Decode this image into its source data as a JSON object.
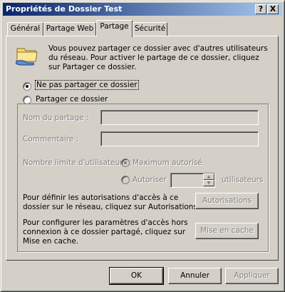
{
  "window": {
    "title": "Propriétés de Dossier Test",
    "help_btn": "?",
    "close_btn": "X"
  },
  "tabs": [
    {
      "label": "Général"
    },
    {
      "label": "Partage Web"
    },
    {
      "label": "Partage"
    },
    {
      "label": "Sécurité"
    }
  ],
  "active_tab": "Partage",
  "intro": {
    "text": "Vous pouvez partager ce dossier avec d'autres utilisateurs\ndu réseau. Pour activer le partage de ce dossier, cliquez\nsur Partager ce dossier."
  },
  "sharing": {
    "no_share_label": "Ne pas partager ce dossier",
    "share_label": "Partager ce dossier",
    "selected": "no_share"
  },
  "fields": {
    "share_name_label": "Nom du partage :",
    "comment_label": "Commentaire :",
    "user_limit_label": "Nombre limite d'utilisateurs :",
    "max_allowed_label": "Maximum autorisé",
    "allow_label": "Autoriser",
    "users_suffix": "utilisateurs"
  },
  "permissions": {
    "text": "Pour définir les autorisations d'accès à ce\ndossier sur le réseau, cliquez sur Autorisations.",
    "button": "Autorisations"
  },
  "caching": {
    "text": "Pour configurer les paramètres d'accès hors\nconnexion à ce dossier partagé, cliquez sur\nMise en cache.",
    "button": "Mise en cache"
  },
  "footer": {
    "ok": "OK",
    "cancel": "Annuler",
    "apply": "Appliquer"
  },
  "colors": {
    "titlebar_start": "#0a246a",
    "titlebar_end": "#a6caf0",
    "face": "#d4d0c8",
    "disabled_text": "#808080"
  },
  "icons": {
    "folder": "shared-folder-hand-icon"
  }
}
